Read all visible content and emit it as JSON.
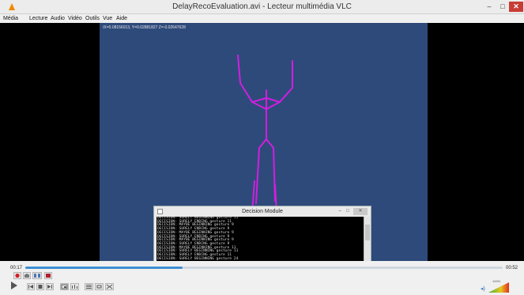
{
  "window": {
    "title": "DelayRecoEvaluation.avi - Lecteur multimédia VLC",
    "minimize_glyph": "–",
    "maximize_glyph": "□",
    "close_glyph": "✕"
  },
  "menu": {
    "media": "Média",
    "playback": "Lecture",
    "audio": "Audio",
    "video": "Vidéo",
    "tools": "Outils",
    "view": "Vue",
    "help": "Aide"
  },
  "video": {
    "coordinates": "/X=0.08156013, Y=0.02881827 Z=-0.02647628",
    "scene_color": "#2e4a7b",
    "skeleton_color": "#d21ee0"
  },
  "dialog": {
    "title": "Decision Module",
    "lines": [
      "DECISION: SURELY BEGINNING gesture 11",
      "DECISION: SURELY ENDING gesture 11",
      "DECISION: MAYBE BEGINNING gesture 9",
      "DECISION: SURELY ENDING gesture 9",
      "DECISION: MAYBE BEGINNING gesture 9",
      "DECISION: SURELY ENDING gesture 9",
      "DECISION: MAYBE BEGINNING gesture 9",
      "DECISION: SURELY ENDING gesture 9",
      "DECISION: MAYBE BEGINNING gesture 11",
      "DECISION: SURELY BEGINNING gesture 11",
      "DECISION: SURELY ENDING gesture 11",
      "DECISION: SURELY BEGINNING gesture 24"
    ]
  },
  "playback": {
    "elapsed": "00:17",
    "total": "00:52",
    "progress_fraction": 0.33
  },
  "volume": {
    "level_label": "100%",
    "fraction": 1.0
  },
  "colors": {
    "accent": "#3f8fd2",
    "close": "#c83c36",
    "record": "#d02020"
  }
}
